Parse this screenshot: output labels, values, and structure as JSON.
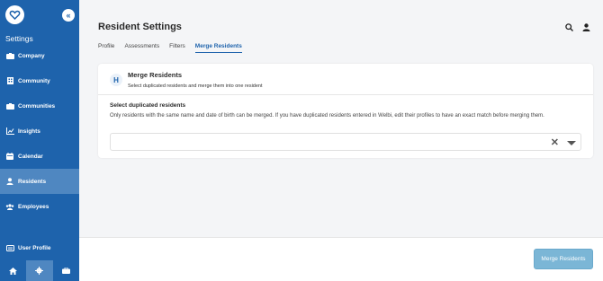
{
  "sidebar": {
    "title": "Settings",
    "collapse_glyph": "«",
    "items": [
      {
        "label": "Company",
        "icon": "building-icon"
      },
      {
        "label": "Community",
        "icon": "community-icon"
      },
      {
        "label": "Communities",
        "icon": "communities-icon"
      },
      {
        "label": "Insights",
        "icon": "chart-icon"
      },
      {
        "label": "Calendar",
        "icon": "calendar-icon"
      },
      {
        "label": "Residents",
        "icon": "person-icon",
        "active": true
      },
      {
        "label": "Employees",
        "icon": "group-icon"
      }
    ],
    "user_profile": "User Profile",
    "bottom_tabs": [
      "home-icon",
      "gear-icon",
      "briefcase-icon"
    ]
  },
  "header": {
    "title": "Resident Settings"
  },
  "tabs": [
    {
      "label": "Profile"
    },
    {
      "label": "Assessments"
    },
    {
      "label": "Filters"
    },
    {
      "label": "Merge Residents",
      "active": true
    }
  ],
  "card": {
    "icon_letter": "H",
    "title": "Merge Residents",
    "subtitle": "Select duplicated residents and merge them into one resident",
    "section_label": "Select duplicated residents",
    "section_desc": "Only residents with the same name and date of birth can be merged. If you have duplicated residents entered in Welbi, edit their profiles to have an exact match before merging them.",
    "clear_glyph": "✕"
  },
  "footer": {
    "merge_button": "Merge Residents"
  },
  "colors": {
    "sidebar": "#1e63ac",
    "active_item": "#4f87c1",
    "button": "#7bb6d6"
  }
}
